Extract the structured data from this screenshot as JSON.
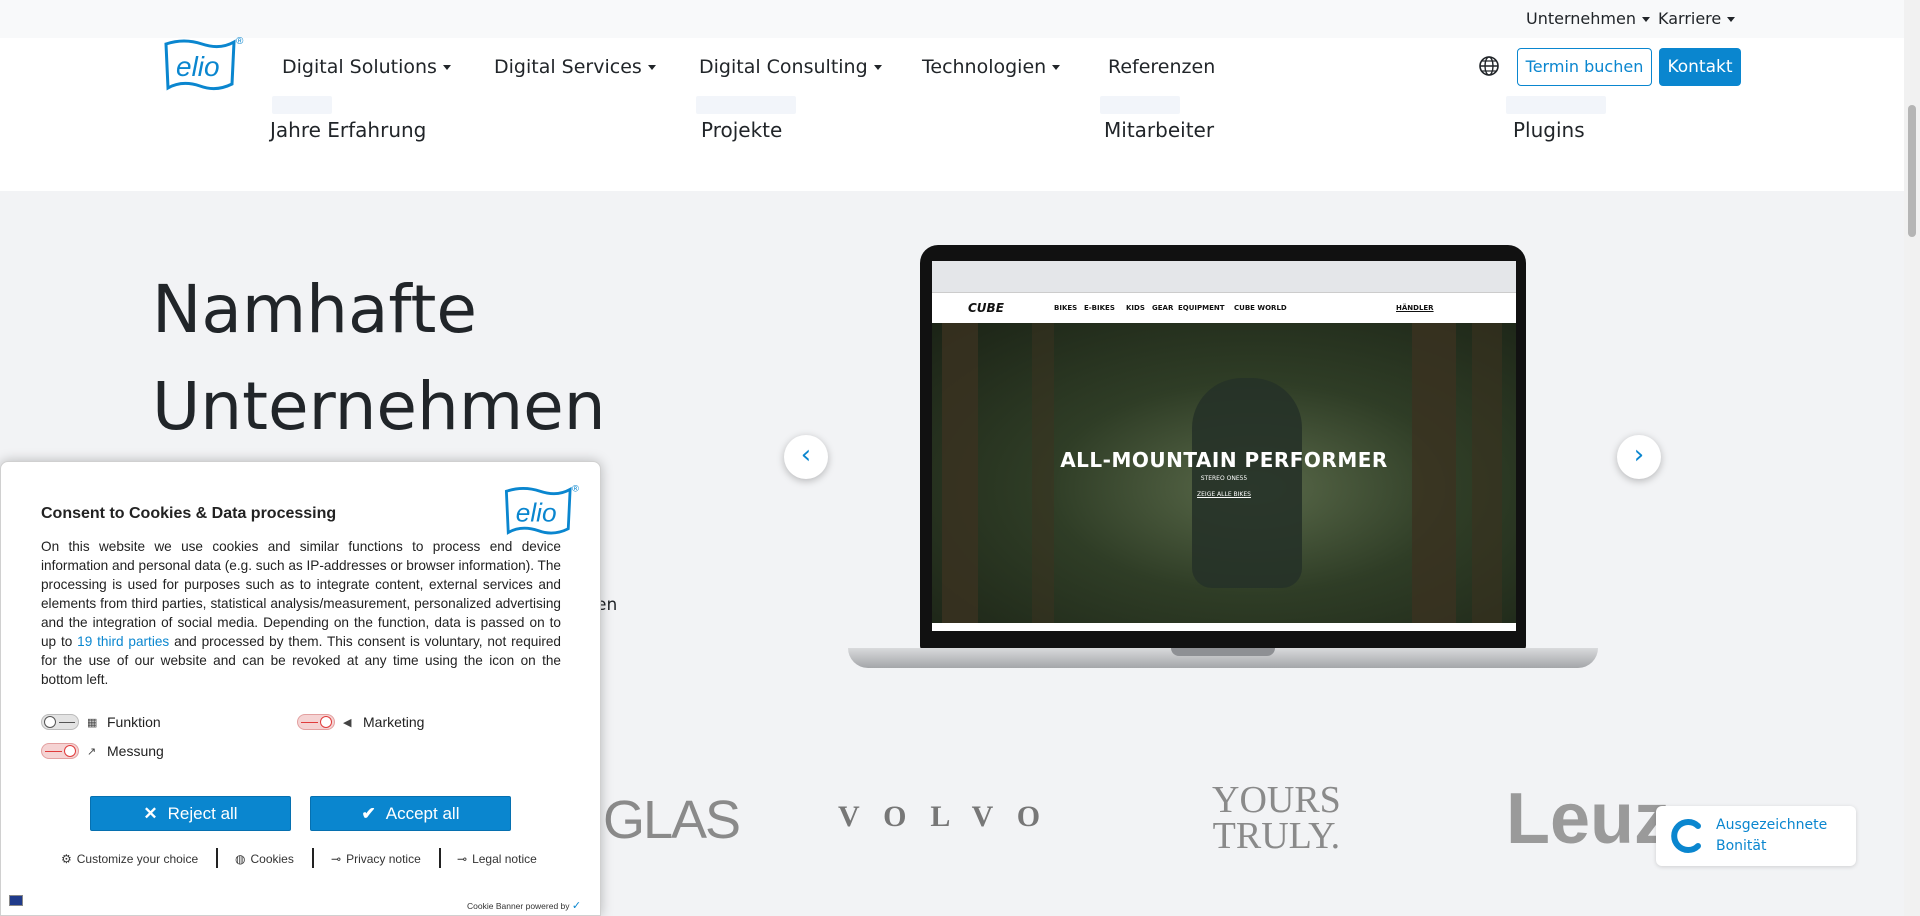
{
  "util_bar": {
    "items": [
      "Unternehmen",
      "Karriere"
    ]
  },
  "header": {
    "logo_text": "elio",
    "nav": [
      "Digital Solutions",
      "Digital Services",
      "Digital Consulting",
      "Technologien",
      "Referenzen"
    ],
    "btn_termin": "Termin buchen",
    "btn_kontakt": "Kontakt"
  },
  "stats": {
    "labels": [
      "Jahre Erfahrung",
      "Projekte",
      "Mitarbeiter",
      "Plugins"
    ]
  },
  "main": {
    "headline_line1": "Namhafte",
    "headline_line2": "Unternehmen",
    "partial_text": "en",
    "carousel": {
      "prev_glyph": "‹",
      "next_glyph": "›",
      "site_brand": "CUBE",
      "site_nav": [
        "BIKES",
        "E-BIKES",
        "KIDS",
        "GEAR",
        "EQUIPMENT",
        "CUBE WORLD"
      ],
      "site_dealer": "HÄNDLER",
      "hero_title": "ALL-MOUNTAIN PERFORMER",
      "hero_sub": "STEREO ONE55",
      "hero_cta": "ZEIGE ALLE BIKES"
    },
    "brand_logos": [
      "UGLAS",
      "VOLVO",
      "YOURS",
      "TRULY.",
      "Leuz"
    ]
  },
  "badge": {
    "line1": "Ausgezeichnete",
    "line2": "Bonität"
  },
  "cookie": {
    "title": "Consent to Cookies & Data processing",
    "body_part1": "On this website we use cookies and similar functions to process end device information and personal data (e.g. such as IP-addresses or browser information). The processing is used for purposes such as to integrate content, external services and elements from third parties, statistical analysis/measurement, personalized advertising and the integration of social media. Depending on the function, data is passed on to up to ",
    "body_link": "19 third parties",
    "body_part2": " and processed by them. This consent is voluntary, not required for the use of our website and can be revoked at any time using the icon on the bottom left.",
    "categories": [
      "Funktion",
      "Marketing",
      "Messung"
    ],
    "btn_reject": "Reject all",
    "btn_accept": "Accept all",
    "footer_links": [
      "Customize your choice",
      "Cookies",
      "Privacy notice",
      "Legal notice"
    ],
    "powered_by": "Cookie Banner powered by"
  },
  "colors": {
    "accent": "#0a86cf",
    "text": "#212529",
    "section_bg": "#f2f3f5"
  }
}
